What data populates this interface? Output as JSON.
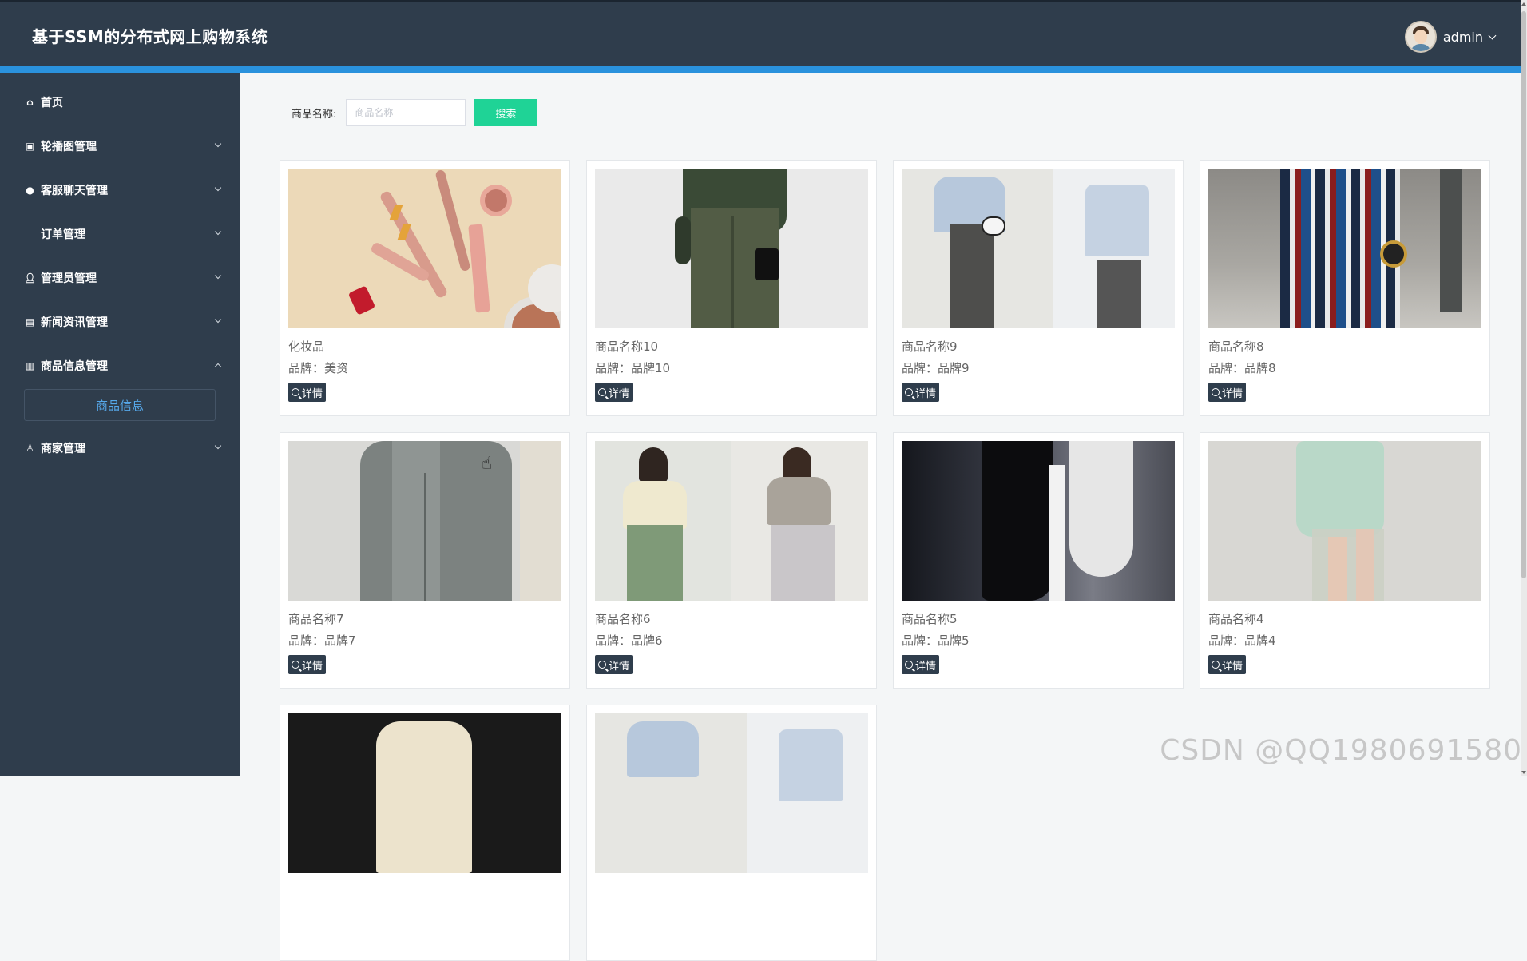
{
  "header": {
    "title": "基于SSM的分布式网上购物系统",
    "username": "admin"
  },
  "sidebar": {
    "items": [
      {
        "label": "首页",
        "icon": "home-icon"
      },
      {
        "label": "轮播图管理",
        "icon": "image-icon"
      },
      {
        "label": "客服聊天管理",
        "icon": "chat-icon"
      },
      {
        "label": "订单管理",
        "icon": ""
      },
      {
        "label": "管理员管理",
        "icon": "user-icon"
      },
      {
        "label": "新闻资讯管理",
        "icon": "news-icon"
      },
      {
        "label": "商品信息管理",
        "icon": "book-icon"
      },
      {
        "label": "商家管理",
        "icon": "shop-icon"
      }
    ],
    "sub_item": "商品信息"
  },
  "search": {
    "label": "商品名称:",
    "placeholder": "商品名称",
    "button": "搜索"
  },
  "detail_label": "详情",
  "products": [
    {
      "name": "化妆品",
      "brand": "品牌：美资"
    },
    {
      "name": "商品名称10",
      "brand": "品牌：品牌10"
    },
    {
      "name": "商品名称9",
      "brand": "品牌：品牌9"
    },
    {
      "name": "商品名称8",
      "brand": "品牌：品牌8"
    },
    {
      "name": "商品名称7",
      "brand": "品牌：品牌7"
    },
    {
      "name": "商品名称6",
      "brand": "品牌：品牌6"
    },
    {
      "name": "商品名称5",
      "brand": "品牌：品牌5"
    },
    {
      "name": "商品名称4",
      "brand": "品牌：品牌4"
    }
  ],
  "watermark": "CSDN @QQ1980691580",
  "colors": {
    "header": "#2f3d4c",
    "accent_bar": "#2a92dd",
    "search_button": "#1fd396",
    "submenu_text": "#56a8ea"
  }
}
